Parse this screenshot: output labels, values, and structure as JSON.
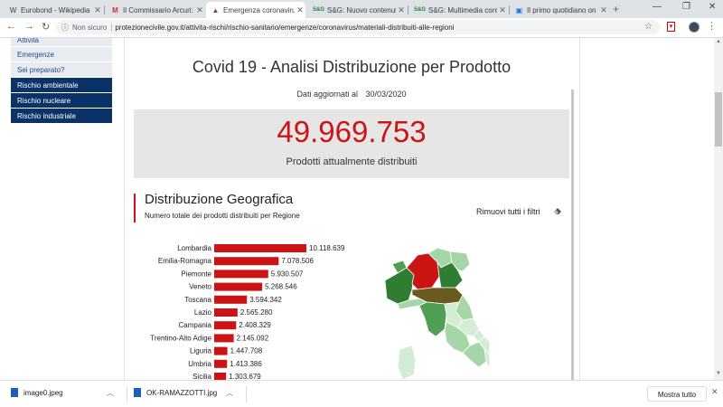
{
  "browser": {
    "tabs": [
      {
        "favicon": "W",
        "title": "Eurobond - Wikipedia",
        "color": "#000000"
      },
      {
        "favicon": "M",
        "title": "Il Commissario Arcuri: \"",
        "color": "#d93025"
      },
      {
        "favicon": "▲",
        "title": "Emergenza coronavirus",
        "color": "#555555",
        "active": true
      },
      {
        "favicon": "S&G",
        "title": "S&G: Nuovo contenuto",
        "color": "#1a7f4b"
      },
      {
        "favicon": "S&G",
        "title": "S&G: Multimedia conte",
        "color": "#1a7f4b"
      },
      {
        "favicon": "▣",
        "title": "Il primo quotidiano on",
        "color": "#1a73e8"
      }
    ],
    "new_tab": "+",
    "window_controls": {
      "minimize": "—",
      "restore": "❐",
      "close": "✕"
    },
    "nav": {
      "back": "←",
      "forward": "→",
      "reload": "↻"
    },
    "security_label": "Non sicuro",
    "url": "protezionecivile.gov.it/attivita-rischi/rischio-sanitario/emergenze/coronavirus/materiali-distribuiti-alle-regioni"
  },
  "sidenav": {
    "items": [
      {
        "label": "Attività",
        "style": "light"
      },
      {
        "label": "Emergenze",
        "style": "light"
      },
      {
        "label": "Sei preparato?",
        "style": "light"
      },
      {
        "label": "Rischio ambientale",
        "style": "dark"
      },
      {
        "label": "Rischio nucleare",
        "style": "dark"
      },
      {
        "label": "Rischio industriale",
        "style": "dark"
      }
    ]
  },
  "dashboard": {
    "title": "Covid 19 - Analisi Distribuzione per Prodotto",
    "updated_label": "Dati aggiornati al",
    "updated_date": "30/03/2020",
    "total_value": "49.969.753",
    "total_label": "Prodotti attualmente distribuiti",
    "section_title": "Distribuzione Geografica",
    "section_subtitle": "Numero totale dei prodotti distribuiti per Regione",
    "remove_filters": "Rimuovi tutti i filtri"
  },
  "chart_data": {
    "type": "bar",
    "orientation": "horizontal",
    "color": "#cc1414",
    "categories": [
      "Lombardia",
      "Emilia-Romagna",
      "Piemonte",
      "Veneto",
      "Toscana",
      "Lazio",
      "Campania",
      "Trentino-Alto Adige",
      "Liguria",
      "Umbria",
      "Sicilia"
    ],
    "values": [
      10118639,
      7078506,
      5930507,
      5268546,
      3594342,
      2565280,
      2408329,
      2145092,
      1447708,
      1413386,
      1303679
    ],
    "value_labels": [
      "10.118.639",
      "7.078.506",
      "5.930.507",
      "5.268.546",
      "3.594.342",
      "2.565.280",
      "2.408.329",
      "2.145.092",
      "1.447.708",
      "1.413.386",
      "1.303.679"
    ]
  },
  "map": {
    "colors": {
      "high": "#cc1414",
      "dark_green": "#2e7d32",
      "mid_green": "#4f9f55",
      "olive": "#6b5a1f",
      "light_green": "#a5d6a7",
      "pale_green": "#d4ecd4"
    }
  },
  "downloads": {
    "items": [
      {
        "name": "image0.jpeg"
      },
      {
        "name": "OK-RAMAZZOTTI.jpg"
      }
    ],
    "show_all": "Mostra tutto",
    "close": "✕"
  }
}
